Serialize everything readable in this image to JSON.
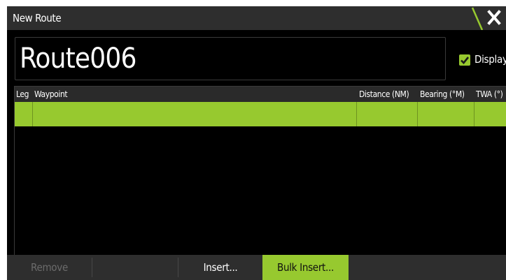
{
  "dialog": {
    "title": "New Route",
    "close_icon": "close-icon",
    "accent_color": "#97c92f"
  },
  "route": {
    "name": "Route006",
    "display_label": "Display",
    "display_checked": true
  },
  "table": {
    "columns": {
      "leg": "Leg",
      "waypoint": "Waypoint",
      "distance": "Distance (NM)",
      "bearing": "Bearing (°M)",
      "twa": "TWA (°)"
    },
    "rows": [
      {
        "leg": "",
        "waypoint": "",
        "distance": "",
        "bearing": "",
        "twa": ""
      }
    ]
  },
  "buttons": {
    "remove": "Remove",
    "insert": "Insert...",
    "bulk_insert": "Bulk Insert..."
  }
}
